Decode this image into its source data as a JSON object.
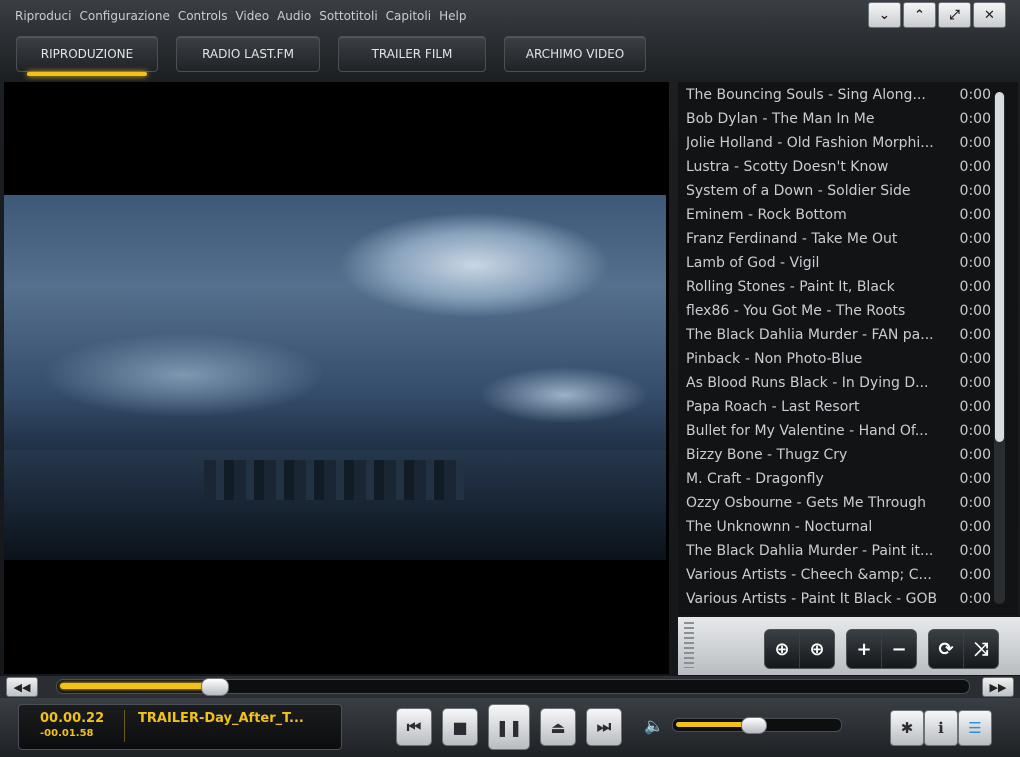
{
  "menu": [
    "Riproduci",
    "Configurazione",
    "Controls",
    "Video",
    "Audio",
    "Sottotitoli",
    "Capitoli",
    "Help"
  ],
  "window_controls": {
    "minimize_glyph": "⌄",
    "restore_glyph": "⌃",
    "maximize_glyph": "⤢",
    "close_glyph": "✕"
  },
  "tabs": [
    {
      "label": "RIPRODUZIONE",
      "active": true
    },
    {
      "label": "RADIO LAST.FM",
      "active": false
    },
    {
      "label": "TRAILER FILM",
      "active": false
    },
    {
      "label": "ARCHIMO VIDEO",
      "active": false
    }
  ],
  "playlist": [
    {
      "title": "The Bouncing Souls - Sing Along...",
      "duration": "0:00"
    },
    {
      "title": "Bob Dylan - The Man In Me",
      "duration": "0:00"
    },
    {
      "title": "Jolie Holland - Old Fashion Morphi...",
      "duration": "0:00"
    },
    {
      "title": "Lustra - Scotty Doesn't Know",
      "duration": "0:00"
    },
    {
      "title": "System of a Down - Soldier Side",
      "duration": "0:00"
    },
    {
      "title": "Eminem - Rock Bottom",
      "duration": "0:00"
    },
    {
      "title": "Franz Ferdinand - Take Me Out",
      "duration": "0:00"
    },
    {
      "title": "Lamb of God - Vigil",
      "duration": "0:00"
    },
    {
      "title": "Rolling Stones - Paint It, Black",
      "duration": "0:00"
    },
    {
      "title": "flex86 - You Got Me - The Roots",
      "duration": "0:00"
    },
    {
      "title": "The Black Dahlia Murder - FAN pa...",
      "duration": "0:00"
    },
    {
      "title": "Pinback - Non Photo-Blue",
      "duration": "0:00"
    },
    {
      "title": "As Blood Runs Black - In Dying D...",
      "duration": "0:00"
    },
    {
      "title": "Papa Roach - Last Resort",
      "duration": "0:00"
    },
    {
      "title": "Bullet for My Valentine - Hand Of...",
      "duration": "0:00"
    },
    {
      "title": "Bizzy Bone - Thugz Cry",
      "duration": "0:00"
    },
    {
      "title": "M. Craft - Dragonfly",
      "duration": "0:00"
    },
    {
      "title": "Ozzy Osbourne - Gets Me Through",
      "duration": "0:00"
    },
    {
      "title": "The Unknownn - Nocturnal",
      "duration": "0:00"
    },
    {
      "title": "The Black Dahlia Murder - Paint it...",
      "duration": "0:00"
    },
    {
      "title": "Various Artists - Cheech &amp; C...",
      "duration": "0:00"
    },
    {
      "title": "Various Artists - Paint It Black - GOB",
      "duration": "0:00"
    }
  ],
  "playlist_controls": [
    {
      "icon": "move-down-icon",
      "glyph": "⊕"
    },
    {
      "icon": "move-up-icon",
      "glyph": "⊕"
    },
    {
      "icon": "add-icon",
      "glyph": "+"
    },
    {
      "icon": "remove-icon",
      "glyph": "−"
    },
    {
      "icon": "repeat-icon",
      "glyph": "⟳"
    },
    {
      "icon": "shuffle-icon",
      "glyph": "⤨"
    }
  ],
  "seek": {
    "progress": 0.17,
    "rewind_glyph": "◀◀",
    "forward_glyph": "▶▶"
  },
  "now_playing": {
    "elapsed": "00.00.22",
    "remaining": "-00.01.58",
    "title": "TRAILER-Day_After_T..."
  },
  "transport": {
    "prev_glyph": "⏮",
    "stop_glyph": "■",
    "pause_glyph": "❚❚",
    "eject_glyph": "⏏",
    "next_glyph": "⏭"
  },
  "volume": {
    "level": 0.48,
    "glyph": "🔈"
  },
  "right_buttons": {
    "settings_glyph": "✱",
    "info_glyph": "ℹ",
    "playlist_glyph": "☰"
  },
  "colors": {
    "accent": "#f2c21a",
    "playlist_active_icon": "#2f8fd8"
  }
}
